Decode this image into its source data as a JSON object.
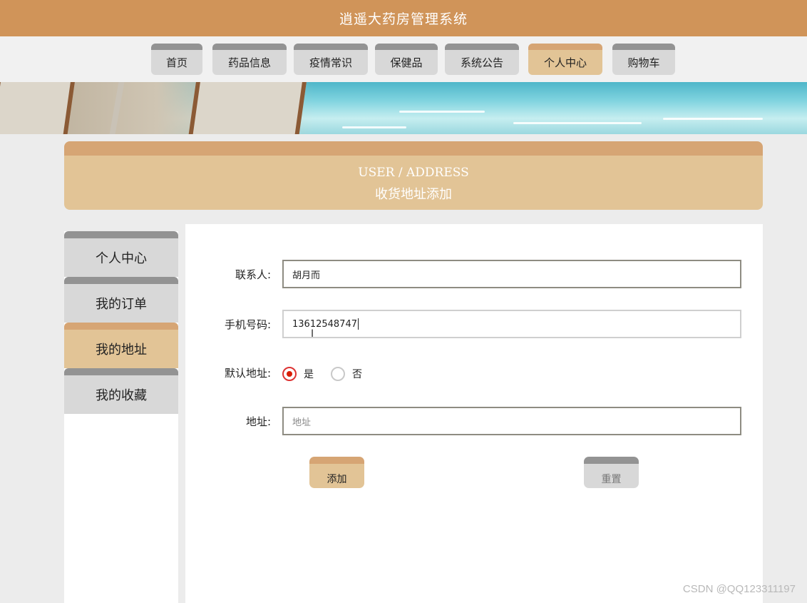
{
  "header": {
    "title": "逍遥大药房管理系统"
  },
  "nav": {
    "items": [
      {
        "label": "首页"
      },
      {
        "label": "药品信息"
      },
      {
        "label": "疫情常识"
      },
      {
        "label": "保健品"
      },
      {
        "label": "系统公告"
      },
      {
        "label": "个人中心",
        "active": true
      },
      {
        "label": "购物车"
      }
    ]
  },
  "section": {
    "title_en": "USER / ADDRESS",
    "title_cn": "收货地址添加"
  },
  "sidebar": {
    "items": [
      {
        "label": "个人中心"
      },
      {
        "label": "我的订单"
      },
      {
        "label": "我的地址",
        "active": true
      },
      {
        "label": "我的收藏"
      }
    ]
  },
  "form": {
    "contact": {
      "label": "联系人:",
      "value": "胡月而"
    },
    "phone": {
      "label": "手机号码:",
      "value": "13612548747"
    },
    "default": {
      "label": "默认地址:",
      "yes": "是",
      "no": "否",
      "selected": "是"
    },
    "address": {
      "label": "地址:",
      "placeholder": "地址"
    },
    "add_label": "添加",
    "reset_label": "重置"
  },
  "watermark": "CSDN @QQ123311197",
  "colors": {
    "brand": "#d09459",
    "accent": "#e2c496",
    "accent_top": "#d6a574",
    "gray_top": "#939393"
  }
}
